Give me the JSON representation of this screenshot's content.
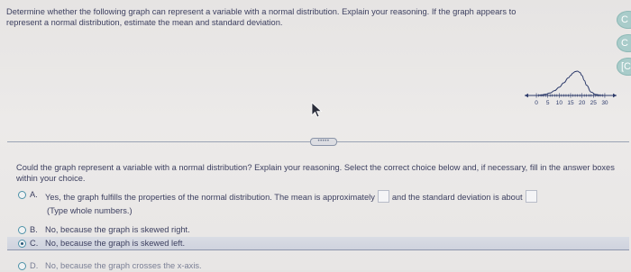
{
  "question": {
    "text": "Determine whether the following graph can represent a variable with a normal distribution. Explain your reasoning. If the graph appears to represent a normal distribution, estimate the mean and standard deviation."
  },
  "side_buttons": [
    {
      "label": "C",
      "icon": "circle-button"
    },
    {
      "label": "C",
      "icon": "circle-button"
    },
    {
      "label": "[C",
      "icon": "circle-button"
    }
  ],
  "chart_data": {
    "type": "line",
    "description_shape": "bell-shaped curve skewed to the left",
    "x_ticks": [
      "0",
      "5",
      "10",
      "15",
      "20",
      "25",
      "30"
    ],
    "xlim": [
      -2,
      32
    ],
    "curve": {
      "x": [
        0,
        2,
        4,
        6,
        8,
        10,
        12,
        14,
        15,
        16,
        17,
        18,
        19,
        20,
        21,
        22,
        24,
        26,
        28,
        30,
        32
      ],
      "y": [
        0,
        0.02,
        0.05,
        0.1,
        0.2,
        0.34,
        0.52,
        0.72,
        0.82,
        0.92,
        0.98,
        1.0,
        0.95,
        0.82,
        0.62,
        0.42,
        0.14,
        0.04,
        0.01,
        0,
        0
      ]
    },
    "arrows": "both-ends",
    "accent_color": "#2c3a6a"
  },
  "more_indicator": "•••••",
  "prompt": {
    "text": "Could the graph represent a variable with a normal distribution? Explain your reasoning. Select the correct choice below and, if necessary, fill in the answer boxes within your choice."
  },
  "choices": [
    {
      "letter": "A.",
      "text_before": "Yes, the graph fulfills the properties of the normal distribution. The mean is approximately",
      "text_middle": "and the standard deviation is about",
      "hint": "(Type whole numbers.)",
      "selected": false
    },
    {
      "letter": "B.",
      "text": "No, because the graph is skewed right.",
      "selected": false
    },
    {
      "letter": "C.",
      "text": "No, because the graph is skewed left.",
      "selected": true
    },
    {
      "letter": "D.",
      "text": "No, because the graph crosses the x-axis.",
      "selected": false
    }
  ],
  "colors": {
    "radio_border": "#4e92a8",
    "text": "#3d4060",
    "side_button": "#a9ccca"
  }
}
